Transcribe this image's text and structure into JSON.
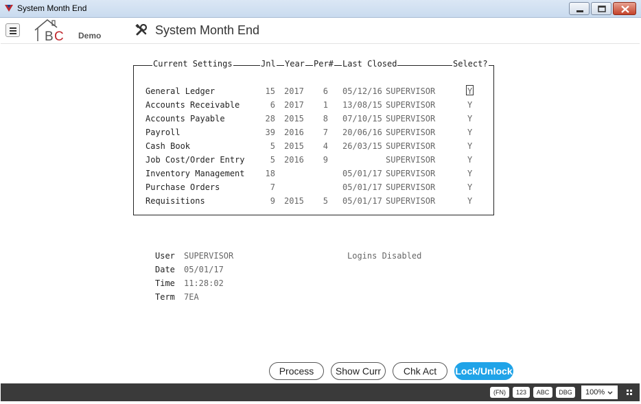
{
  "window": {
    "title": "System Month End"
  },
  "header": {
    "logo_suffix": "Demo",
    "title": "System Month End"
  },
  "settings": {
    "legend": "Current Settings",
    "columns": {
      "jnl": "Jnl",
      "year": "Year",
      "per": "Per#",
      "last_closed": "Last Closed",
      "select": "Select?"
    },
    "rows": [
      {
        "module": "General Ledger",
        "jnl": "15",
        "year": "2017",
        "per": "6",
        "date": "05/12/16",
        "user": "SUPERVISOR",
        "select": "Y"
      },
      {
        "module": "Accounts Receivable",
        "jnl": "6",
        "year": "2017",
        "per": "1",
        "date": "13/08/15",
        "user": "SUPERVISOR",
        "select": "Y"
      },
      {
        "module": "Accounts Payable",
        "jnl": "28",
        "year": "2015",
        "per": "8",
        "date": "07/10/15",
        "user": "SUPERVISOR",
        "select": "Y"
      },
      {
        "module": "Payroll",
        "jnl": "39",
        "year": "2016",
        "per": "7",
        "date": "20/06/16",
        "user": "SUPERVISOR",
        "select": "Y"
      },
      {
        "module": "Cash Book",
        "jnl": "5",
        "year": "2015",
        "per": "4",
        "date": "26/03/15",
        "user": "SUPERVISOR",
        "select": "Y"
      },
      {
        "module": "Job Cost/Order Entry",
        "jnl": "5",
        "year": "2016",
        "per": "9",
        "date": "",
        "user": "SUPERVISOR",
        "select": "Y"
      },
      {
        "module": "Inventory Management",
        "jnl": "18",
        "year": "",
        "per": "",
        "date": "05/01/17",
        "user": "SUPERVISOR",
        "select": "Y"
      },
      {
        "module": "Purchase Orders",
        "jnl": "7",
        "year": "",
        "per": "",
        "date": "05/01/17",
        "user": "SUPERVISOR",
        "select": "Y"
      },
      {
        "module": "Requisitions",
        "jnl": "9",
        "year": "2015",
        "per": "5",
        "date": "05/01/17",
        "user": "SUPERVISOR",
        "select": "Y"
      }
    ]
  },
  "info": {
    "user_label": "User",
    "user": "SUPERVISOR",
    "date_label": "Date",
    "date": "05/01/17",
    "time_label": "Time",
    "time": "11:28:02",
    "term_label": "Term",
    "term": "7EA",
    "logins_status": "Logins Disabled"
  },
  "buttons": {
    "process": "Process",
    "show_curr": "Show Curr",
    "chk_act": "Chk Act",
    "lock_unlock": "Lock/Unlock"
  },
  "statusbar": {
    "fn": "(FN)",
    "num": "123",
    "abc": "ABC",
    "dbg": "DBG",
    "zoom": "100%"
  },
  "colors": {
    "primary_button": "#1fa3e8",
    "statusbar": "#3a3a3a",
    "logo_red": "#c0282d"
  }
}
